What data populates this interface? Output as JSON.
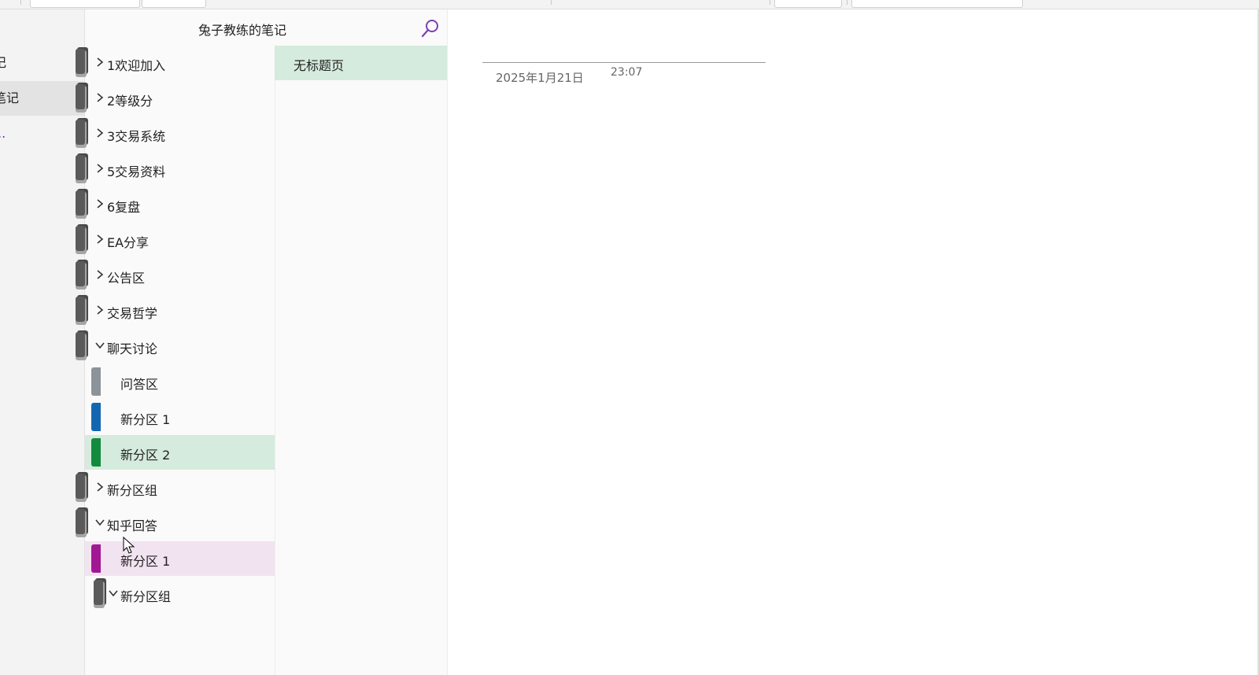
{
  "notebook_pane": {
    "items": [
      {
        "label": "记"
      },
      {
        "label": "笔记",
        "selected": true
      },
      {
        "label": "...",
        "more": true
      }
    ]
  },
  "section_pane": {
    "notebook_title": "兔子教练的笔记",
    "rows": [
      {
        "label": "1欢迎加入",
        "type": "group",
        "expanded": false
      },
      {
        "label": "2等级分",
        "type": "group",
        "expanded": false
      },
      {
        "label": "3交易系统",
        "type": "group",
        "expanded": false
      },
      {
        "label": "5交易资料",
        "type": "group",
        "expanded": false
      },
      {
        "label": "6复盘",
        "type": "group",
        "expanded": false
      },
      {
        "label": "EA分享",
        "type": "group",
        "expanded": false
      },
      {
        "label": "公告区",
        "type": "group",
        "expanded": false
      },
      {
        "label": "交易哲学",
        "type": "group",
        "expanded": false
      },
      {
        "label": "聊天讨论",
        "type": "group",
        "expanded": true
      },
      {
        "label": "问答区",
        "type": "section",
        "color": "#8c949a"
      },
      {
        "label": "新分区 1",
        "type": "section",
        "color": "#1566b0"
      },
      {
        "label": "新分区 2",
        "type": "section",
        "color": "#138a3e",
        "selected": true
      },
      {
        "label": "新分区组",
        "type": "group",
        "expanded": false
      },
      {
        "label": "知乎回答",
        "type": "group",
        "expanded": true
      },
      {
        "label": "新分区 1",
        "type": "section",
        "color": "#a21793",
        "hover": true
      },
      {
        "label": "新分区组",
        "type": "group",
        "expanded": true,
        "nested": true
      }
    ]
  },
  "page_list": {
    "pages": [
      {
        "label": "无标题页",
        "selected": true
      }
    ]
  },
  "page": {
    "date": "2025年1月21日",
    "time": "23:07"
  },
  "colors": {
    "selected_green": "#d5ebdd",
    "hover_pink": "#f2e3f0",
    "search_purple": "#7b3fb5"
  },
  "icons": {
    "search": "search-icon",
    "chevron_right": "chevron-right-icon",
    "chevron_down": "chevron-down-icon",
    "section_group": "section-group-icon",
    "section_tab": "section-tab-icon"
  }
}
